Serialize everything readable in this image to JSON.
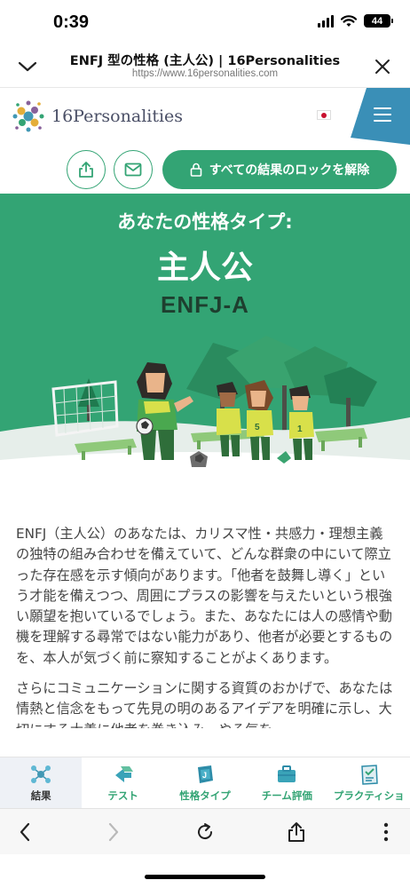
{
  "status_bar": {
    "time": "0:39",
    "battery": "44"
  },
  "browser": {
    "page_title": "ENFJ 型の性格 (主人公) | 16Personalities",
    "url": "https://www.16personalities.com"
  },
  "site": {
    "logo_text": "16Personalities",
    "unlock_label": "すべての結果のロックを解除"
  },
  "hero": {
    "kicker": "あなたの性格タイプ:",
    "title": "主人公",
    "code": "ENFJ-A"
  },
  "article": {
    "paragraph1": "ENFJ（主人公）のあなたは、カリスマ性・共感力・理想主義の独特の組み合わせを備えていて、どんな群衆の中にいて際立った存在感を示す傾向があります。「他者を鼓舞し導く」という才能を備えつつ、周囲にプラスの影響を与えたいという根強い願望を抱いているでしょう。また、あなたには人の感情や動機を理解する尋常ではない能力があり、他者が必要とするものを、本人が気づく前に察知することがよくあります。",
    "paragraph2": "さらにコミュニケーションに関する資質のおかげで、あなたは情熱と信念をもって先見の明のあるアイデアを明確に示し、大切にする大義に他者を巻き込み、やる気を"
  },
  "bottom_nav": [
    {
      "label": "結果",
      "icon": "results-molecule-icon",
      "active": true
    },
    {
      "label": "テスト",
      "icon": "test-arrows-icon",
      "active": false
    },
    {
      "label": "性格タイプ",
      "icon": "personality-types-icon",
      "active": false
    },
    {
      "label": "チーム評価",
      "icon": "team-assessment-briefcase-icon",
      "active": false
    },
    {
      "label": "プラクティショ",
      "icon": "practitioner-clipboard-icon",
      "active": false
    }
  ],
  "colors": {
    "brand_green": "#33a474",
    "menu_blue": "#3a8fb7",
    "code_dark": "#1e3f2f"
  }
}
